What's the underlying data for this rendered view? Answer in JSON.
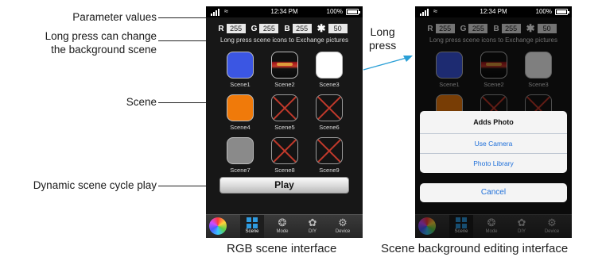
{
  "callouts": {
    "parameter_values": "Parameter values",
    "long_press_line1": "Long press can change",
    "long_press_line2": "the background scene",
    "scene": "Scene",
    "dynamic_play": "Dynamic scene cycle play"
  },
  "arrow": {
    "line1": "Long",
    "line2": "press"
  },
  "captions": {
    "left": "RGB scene interface",
    "right": "Scene background editing interface"
  },
  "status_bar": {
    "time": "12:34 PM",
    "battery": "100%"
  },
  "params": {
    "r_label": "R",
    "r": "255",
    "g_label": "G",
    "g": "255",
    "b_label": "B",
    "b": "255",
    "brightness": "50"
  },
  "hint": "Long press scene icons to Exchange pictures",
  "scenes": [
    {
      "label": "Scene1",
      "kind": "color",
      "color": "#3b56e3"
    },
    {
      "label": "Scene2",
      "kind": "photo"
    },
    {
      "label": "Scene3",
      "kind": "color",
      "color": "#ffffff"
    },
    {
      "label": "Scene4",
      "kind": "color",
      "color": "#f07a0a"
    },
    {
      "label": "Scene5",
      "kind": "empty"
    },
    {
      "label": "Scene6",
      "kind": "empty"
    },
    {
      "label": "Scene7",
      "kind": "color",
      "color": "#8a8a8a"
    },
    {
      "label": "Scene8",
      "kind": "empty"
    },
    {
      "label": "Scene9",
      "kind": "empty"
    }
  ],
  "play_label": "Play",
  "tabs": [
    {
      "label": "Scene",
      "icon": "grid-icon",
      "active": true
    },
    {
      "label": "Mode",
      "icon": "film-reel-icon"
    },
    {
      "label": "DIY",
      "icon": "palette-icon"
    },
    {
      "label": "Device",
      "icon": "gear-icon"
    }
  ],
  "action_sheet": {
    "title": "Adds Photo",
    "option1": "Use Camera",
    "option2": "Photo Library",
    "cancel": "Cancel"
  },
  "colors": {
    "accent": "#2f9be0",
    "ios_blue": "#1e6fd9",
    "arrow": "#2a9fd6"
  }
}
